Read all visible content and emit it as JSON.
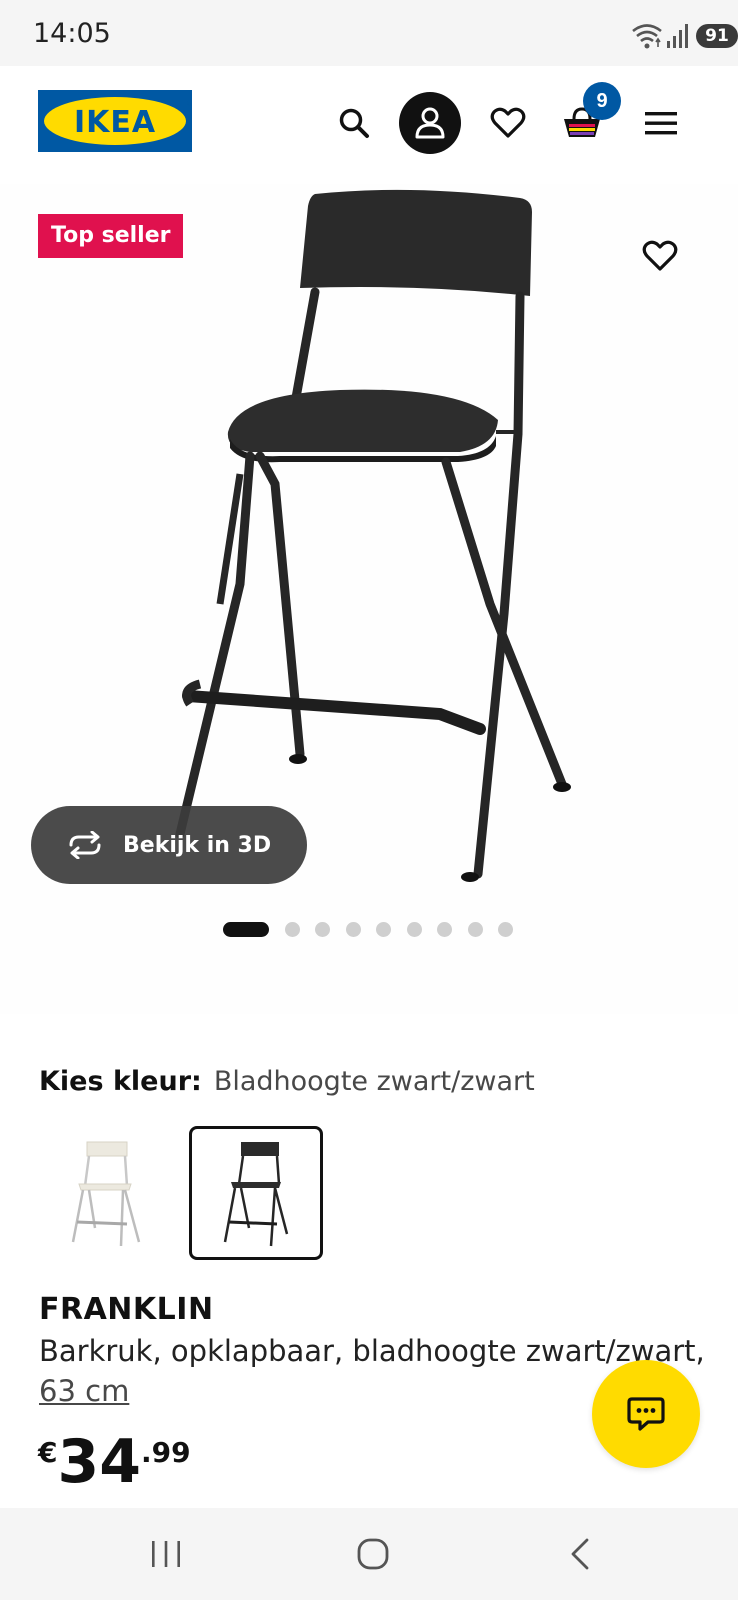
{
  "status_bar": {
    "time": "14:05",
    "battery": "91"
  },
  "header": {
    "logo_text": "IKEA",
    "cart_count": "9"
  },
  "product_media": {
    "badge": "Top seller",
    "view_3d_label": "Bekijk in 3D",
    "carousel": {
      "total": 9,
      "active_index": 0
    }
  },
  "color_select": {
    "label": "Kies kleur:",
    "value": "Bladhoogte zwart/zwart",
    "options": [
      {
        "name": "white",
        "selected": false
      },
      {
        "name": "black",
        "selected": true
      }
    ]
  },
  "product": {
    "name": "FRANKLIN",
    "description": "Barkruk, opklapbaar, bladhoogte zwart/zwart,",
    "size": "63 cm",
    "price": {
      "currency": "€",
      "integer": "34",
      "decimal": ".99"
    }
  },
  "colors": {
    "brand_blue": "#0058a3",
    "brand_yellow": "#ffdb00",
    "badge_red": "#e0114e"
  },
  "icons": [
    "search-icon",
    "account-icon",
    "heart-icon",
    "cart-icon",
    "menu-icon",
    "rotate-3d-icon",
    "chat-icon",
    "recents-icon",
    "home-icon",
    "back-icon"
  ]
}
